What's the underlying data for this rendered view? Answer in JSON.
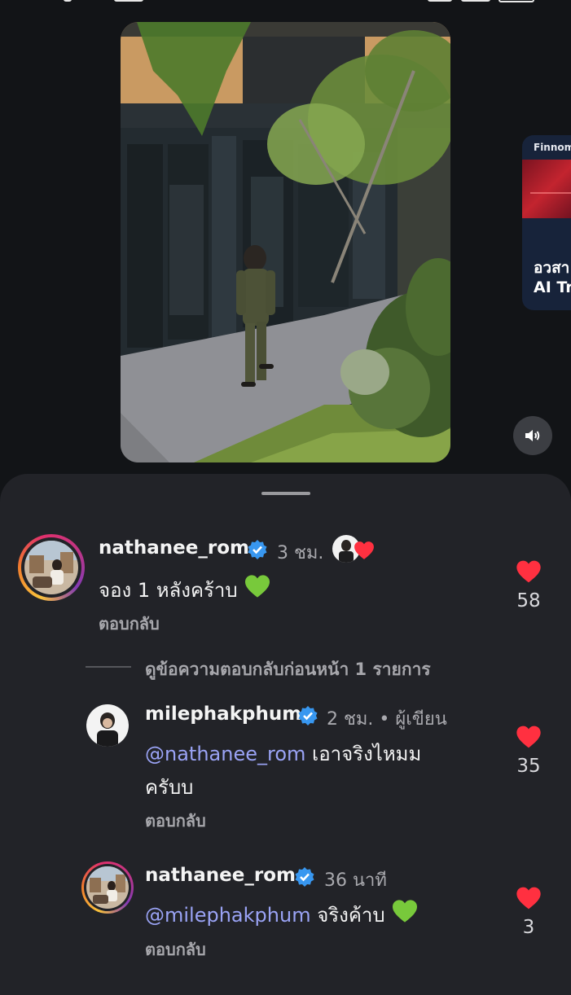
{
  "colors": {
    "background": "#121417",
    "sheet": "#222328",
    "like": "#ff3040",
    "mention": "#9aa3f5",
    "verified": "#3897f0",
    "green_heart": "#78c93b"
  },
  "side_card": {
    "brand": "Finnome",
    "title_line1": "อวสา",
    "title_line2": "AI Tr"
  },
  "media": {
    "sound_icon": "speaker-icon"
  },
  "comments": [
    {
      "username": "nathanee_rom",
      "time": "3 ชม.",
      "text": "จอง 1 หลังคร้าบ",
      "reply_label": "ตอบกลับ",
      "likes": "58"
    }
  ],
  "view_previous": "ดูข้อความตอบกลับก่อนหน้า 1 รายการ",
  "replies": [
    {
      "username": "milephakphum",
      "time": "2 ชม.",
      "author_label": "• ผู้เขียน",
      "mention": "@nathanee_rom",
      "text_line1": " เอาจริงไหมม",
      "text_line2": "ครับบ",
      "reply_label": "ตอบกลับ",
      "likes": "35"
    },
    {
      "username": "nathanee_rom",
      "time": "36 นาที",
      "mention": "@milephakphum",
      "text": " จริงค้าบ",
      "reply_label": "ตอบกลับ",
      "likes": "3"
    }
  ]
}
